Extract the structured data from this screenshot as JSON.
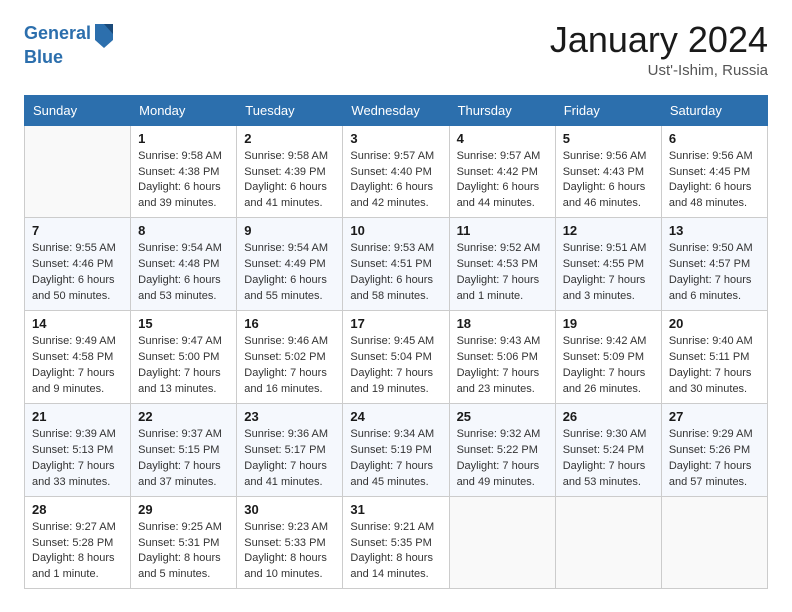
{
  "header": {
    "logo_line1": "General",
    "logo_line2": "Blue",
    "month_title": "January 2024",
    "location": "Ust'-Ishim, Russia"
  },
  "weekdays": [
    "Sunday",
    "Monday",
    "Tuesday",
    "Wednesday",
    "Thursday",
    "Friday",
    "Saturday"
  ],
  "weeks": [
    [
      {
        "day": "",
        "info": ""
      },
      {
        "day": "1",
        "info": "Sunrise: 9:58 AM\nSunset: 4:38 PM\nDaylight: 6 hours\nand 39 minutes."
      },
      {
        "day": "2",
        "info": "Sunrise: 9:58 AM\nSunset: 4:39 PM\nDaylight: 6 hours\nand 41 minutes."
      },
      {
        "day": "3",
        "info": "Sunrise: 9:57 AM\nSunset: 4:40 PM\nDaylight: 6 hours\nand 42 minutes."
      },
      {
        "day": "4",
        "info": "Sunrise: 9:57 AM\nSunset: 4:42 PM\nDaylight: 6 hours\nand 44 minutes."
      },
      {
        "day": "5",
        "info": "Sunrise: 9:56 AM\nSunset: 4:43 PM\nDaylight: 6 hours\nand 46 minutes."
      },
      {
        "day": "6",
        "info": "Sunrise: 9:56 AM\nSunset: 4:45 PM\nDaylight: 6 hours\nand 48 minutes."
      }
    ],
    [
      {
        "day": "7",
        "info": "Sunrise: 9:55 AM\nSunset: 4:46 PM\nDaylight: 6 hours\nand 50 minutes."
      },
      {
        "day": "8",
        "info": "Sunrise: 9:54 AM\nSunset: 4:48 PM\nDaylight: 6 hours\nand 53 minutes."
      },
      {
        "day": "9",
        "info": "Sunrise: 9:54 AM\nSunset: 4:49 PM\nDaylight: 6 hours\nand 55 minutes."
      },
      {
        "day": "10",
        "info": "Sunrise: 9:53 AM\nSunset: 4:51 PM\nDaylight: 6 hours\nand 58 minutes."
      },
      {
        "day": "11",
        "info": "Sunrise: 9:52 AM\nSunset: 4:53 PM\nDaylight: 7 hours\nand 1 minute."
      },
      {
        "day": "12",
        "info": "Sunrise: 9:51 AM\nSunset: 4:55 PM\nDaylight: 7 hours\nand 3 minutes."
      },
      {
        "day": "13",
        "info": "Sunrise: 9:50 AM\nSunset: 4:57 PM\nDaylight: 7 hours\nand 6 minutes."
      }
    ],
    [
      {
        "day": "14",
        "info": "Sunrise: 9:49 AM\nSunset: 4:58 PM\nDaylight: 7 hours\nand 9 minutes."
      },
      {
        "day": "15",
        "info": "Sunrise: 9:47 AM\nSunset: 5:00 PM\nDaylight: 7 hours\nand 13 minutes."
      },
      {
        "day": "16",
        "info": "Sunrise: 9:46 AM\nSunset: 5:02 PM\nDaylight: 7 hours\nand 16 minutes."
      },
      {
        "day": "17",
        "info": "Sunrise: 9:45 AM\nSunset: 5:04 PM\nDaylight: 7 hours\nand 19 minutes."
      },
      {
        "day": "18",
        "info": "Sunrise: 9:43 AM\nSunset: 5:06 PM\nDaylight: 7 hours\nand 23 minutes."
      },
      {
        "day": "19",
        "info": "Sunrise: 9:42 AM\nSunset: 5:09 PM\nDaylight: 7 hours\nand 26 minutes."
      },
      {
        "day": "20",
        "info": "Sunrise: 9:40 AM\nSunset: 5:11 PM\nDaylight: 7 hours\nand 30 minutes."
      }
    ],
    [
      {
        "day": "21",
        "info": "Sunrise: 9:39 AM\nSunset: 5:13 PM\nDaylight: 7 hours\nand 33 minutes."
      },
      {
        "day": "22",
        "info": "Sunrise: 9:37 AM\nSunset: 5:15 PM\nDaylight: 7 hours\nand 37 minutes."
      },
      {
        "day": "23",
        "info": "Sunrise: 9:36 AM\nSunset: 5:17 PM\nDaylight: 7 hours\nand 41 minutes."
      },
      {
        "day": "24",
        "info": "Sunrise: 9:34 AM\nSunset: 5:19 PM\nDaylight: 7 hours\nand 45 minutes."
      },
      {
        "day": "25",
        "info": "Sunrise: 9:32 AM\nSunset: 5:22 PM\nDaylight: 7 hours\nand 49 minutes."
      },
      {
        "day": "26",
        "info": "Sunrise: 9:30 AM\nSunset: 5:24 PM\nDaylight: 7 hours\nand 53 minutes."
      },
      {
        "day": "27",
        "info": "Sunrise: 9:29 AM\nSunset: 5:26 PM\nDaylight: 7 hours\nand 57 minutes."
      }
    ],
    [
      {
        "day": "28",
        "info": "Sunrise: 9:27 AM\nSunset: 5:28 PM\nDaylight: 8 hours\nand 1 minute."
      },
      {
        "day": "29",
        "info": "Sunrise: 9:25 AM\nSunset: 5:31 PM\nDaylight: 8 hours\nand 5 minutes."
      },
      {
        "day": "30",
        "info": "Sunrise: 9:23 AM\nSunset: 5:33 PM\nDaylight: 8 hours\nand 10 minutes."
      },
      {
        "day": "31",
        "info": "Sunrise: 9:21 AM\nSunset: 5:35 PM\nDaylight: 8 hours\nand 14 minutes."
      },
      {
        "day": "",
        "info": ""
      },
      {
        "day": "",
        "info": ""
      },
      {
        "day": "",
        "info": ""
      }
    ]
  ]
}
